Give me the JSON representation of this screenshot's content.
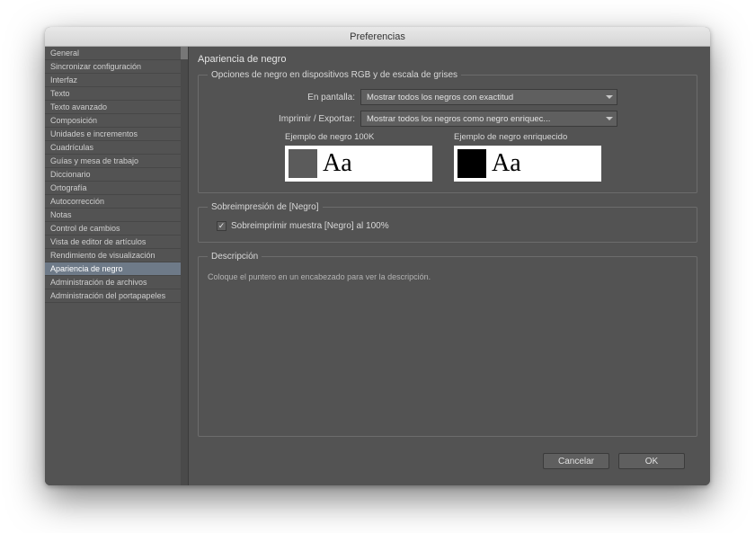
{
  "window": {
    "title": "Preferencias"
  },
  "sidebar": {
    "items": [
      "General",
      "Sincronizar configuración",
      "Interfaz",
      "Texto",
      "Texto avanzado",
      "Composición",
      "Unidades e incrementos",
      "Cuadrículas",
      "Guías y mesa de trabajo",
      "Diccionario",
      "Ortografía",
      "Autocorrección",
      "Notas",
      "Control de cambios",
      "Vista de editor de artículos",
      "Rendimiento de visualización",
      "Apariencia de negro",
      "Administración de archivos",
      "Administración del portapapeles"
    ],
    "selected_index": 16
  },
  "panel": {
    "title": "Apariencia de negro",
    "group1": {
      "legend": "Opciones de negro en dispositivos RGB y de escala de grises",
      "on_screen_label": "En pantalla:",
      "on_screen_value": "Mostrar todos los negros con exactitud",
      "print_label": "Imprimir / Exportar:",
      "print_value": "Mostrar todos los negros como negro enriquec...",
      "example_100k_label": "Ejemplo de negro 100K",
      "example_rich_label": "Ejemplo de negro enriquecido",
      "sample_text": "Aa"
    },
    "group2": {
      "legend": "Sobreimpresión de [Negro]",
      "check_label": "Sobreimprimir muestra [Negro] al 100%",
      "checked": true
    },
    "group3": {
      "legend": "Descripción",
      "hint": "Coloque el puntero en un encabezado para ver la descripción."
    }
  },
  "buttons": {
    "cancel": "Cancelar",
    "ok": "OK"
  }
}
